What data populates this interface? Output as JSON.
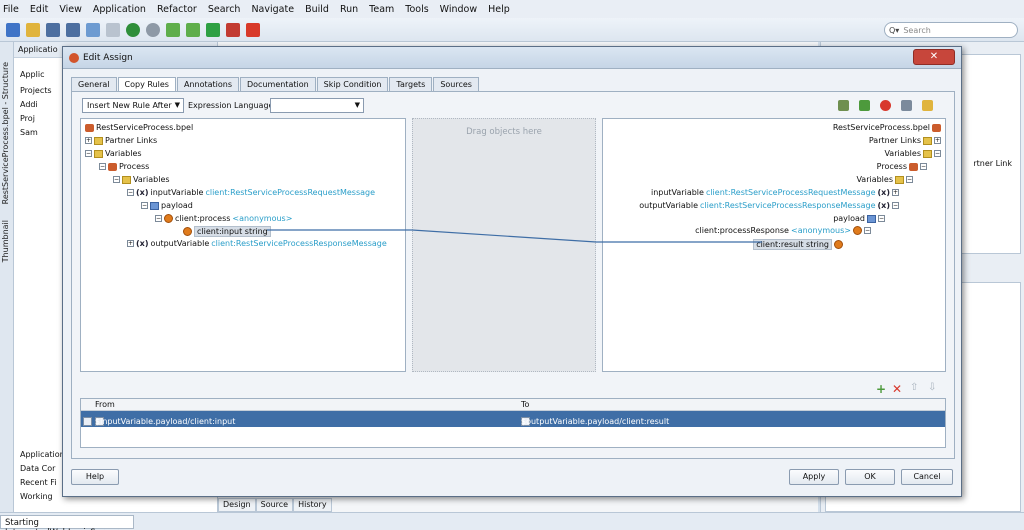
{
  "menu": [
    "File",
    "Edit",
    "View",
    "Application",
    "Refactor",
    "Search",
    "Navigate",
    "Build",
    "Run",
    "Team",
    "Tools",
    "Window",
    "Help"
  ],
  "search": {
    "placeholder": "Search"
  },
  "ide": {
    "left_vertical": [
      "RestServiceProcess.bpel - Structure",
      "Thumbnail"
    ],
    "app_panel_title": "Applicatio",
    "app_rows": [
      "Applic",
      "Projects",
      "Addi",
      "Proj",
      "Sam"
    ],
    "app_bottom": [
      "Application",
      "Data Cor",
      "Recent Fi",
      "Working"
    ],
    "center_tabs": [
      "Design",
      "Source",
      "History"
    ],
    "right_partner_link": "rtner Link",
    "status": "Starting IntegratedWebLogicServer."
  },
  "dialog": {
    "title": "Edit Assign",
    "close_label": "✕",
    "tabs": [
      "General",
      "Copy Rules",
      "Annotations",
      "Documentation",
      "Skip Condition",
      "Targets",
      "Sources"
    ],
    "active_tab": "Copy Rules",
    "insert_rule": "Insert New Rule After",
    "expr_lang_label": "Expression Language:",
    "expr_lang_value": "",
    "middle_hint": "Drag objects here",
    "source_tree": {
      "root": "RestServiceProcess.bpel",
      "partner_links": "Partner Links",
      "variables": "Variables",
      "process": "Process",
      "proc_variables": "Variables",
      "input_var": "inputVariable",
      "input_type": "client:RestServiceProcessRequestMessage",
      "payload": "payload",
      "process_el": "client:process",
      "process_type": "<anonymous>",
      "input_el": "client:input string",
      "output_var": "outputVariable",
      "output_type": "client:RestServiceProcessResponseMessage"
    },
    "target_tree": {
      "root": "RestServiceProcess.bpel",
      "partner_links": "Partner Links",
      "variables": "Variables",
      "process": "Process",
      "proc_variables": "Variables",
      "input_var": "inputVariable",
      "input_type": "client:RestServiceProcessRequestMessage",
      "output_var": "outputVariable",
      "output_type": "client:RestServiceProcessResponseMessage",
      "payload": "payload",
      "response_el": "client:processResponse",
      "response_type": "<anonymous>",
      "result_el": "client:result string"
    },
    "grid": {
      "from_header": "From",
      "to_header": "To",
      "rows": [
        {
          "from": "$inputVariable.payload/client:input",
          "to": "$outputVariable.payload/client:result"
        }
      ]
    },
    "buttons": {
      "help": "Help",
      "apply": "Apply",
      "ok": "OK",
      "cancel": "Cancel"
    }
  }
}
